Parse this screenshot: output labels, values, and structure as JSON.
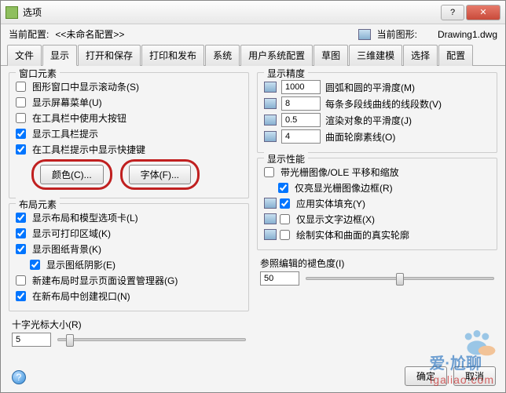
{
  "title": "选项",
  "config_label": "当前配置:",
  "config_value": "<<未命名配置>>",
  "drawing_label": "当前图形:",
  "drawing_value": "Drawing1.dwg",
  "tabs": [
    "文件",
    "显示",
    "打开和保存",
    "打印和发布",
    "系统",
    "用户系统配置",
    "草图",
    "三维建模",
    "选择",
    "配置"
  ],
  "active_tab": 1,
  "group_window": "窗口元素",
  "win_items": [
    "图形窗口中显示滚动条(S)",
    "显示屏幕菜单(U)",
    "在工具栏中使用大按钮",
    "显示工具栏提示",
    "在工具栏提示中显示快捷键"
  ],
  "win_checked": [
    false,
    false,
    false,
    true,
    true
  ],
  "color_btn": "颜色(C)...",
  "font_btn": "字体(F)...",
  "group_layout": "布局元素",
  "layout_items": [
    "显示布局和模型选项卡(L)",
    "显示可打印区域(K)",
    "显示图纸背景(K)",
    "显示图纸阴影(E)",
    "新建布局时显示页面设置管理器(G)",
    "在新布局中创建视口(N)"
  ],
  "layout_checked": [
    true,
    true,
    true,
    true,
    false,
    true
  ],
  "layout_indent": [
    false,
    false,
    false,
    true,
    false,
    false
  ],
  "cross_label": "十字光标大小(R)",
  "cross_value": "5",
  "group_precision": "显示精度",
  "prec_rows": [
    {
      "val": "1000",
      "label": "圆弧和圆的平滑度(M)"
    },
    {
      "val": "8",
      "label": "每条多段线曲线的线段数(V)"
    },
    {
      "val": "0.5",
      "label": "渲染对象的平滑度(J)"
    },
    {
      "val": "4",
      "label": "曲面轮廓素线(O)"
    }
  ],
  "group_perf": "显示性能",
  "perf_items": [
    "带光栅图像/OLE 平移和缩放",
    "仅亮显光栅图像边框(R)",
    "应用实体填充(Y)",
    "仅显示文字边框(X)",
    "绘制实体和曲面的真实轮廓"
  ],
  "perf_checked": [
    false,
    true,
    true,
    false,
    false
  ],
  "perf_icon": [
    false,
    false,
    true,
    true,
    true
  ],
  "ref_label": "参照编辑的褪色度(I)",
  "ref_value": "50",
  "ok": "确定",
  "cancel": "取消",
  "wm1": "爱·尬聊",
  "wm2": "igaliao.com"
}
